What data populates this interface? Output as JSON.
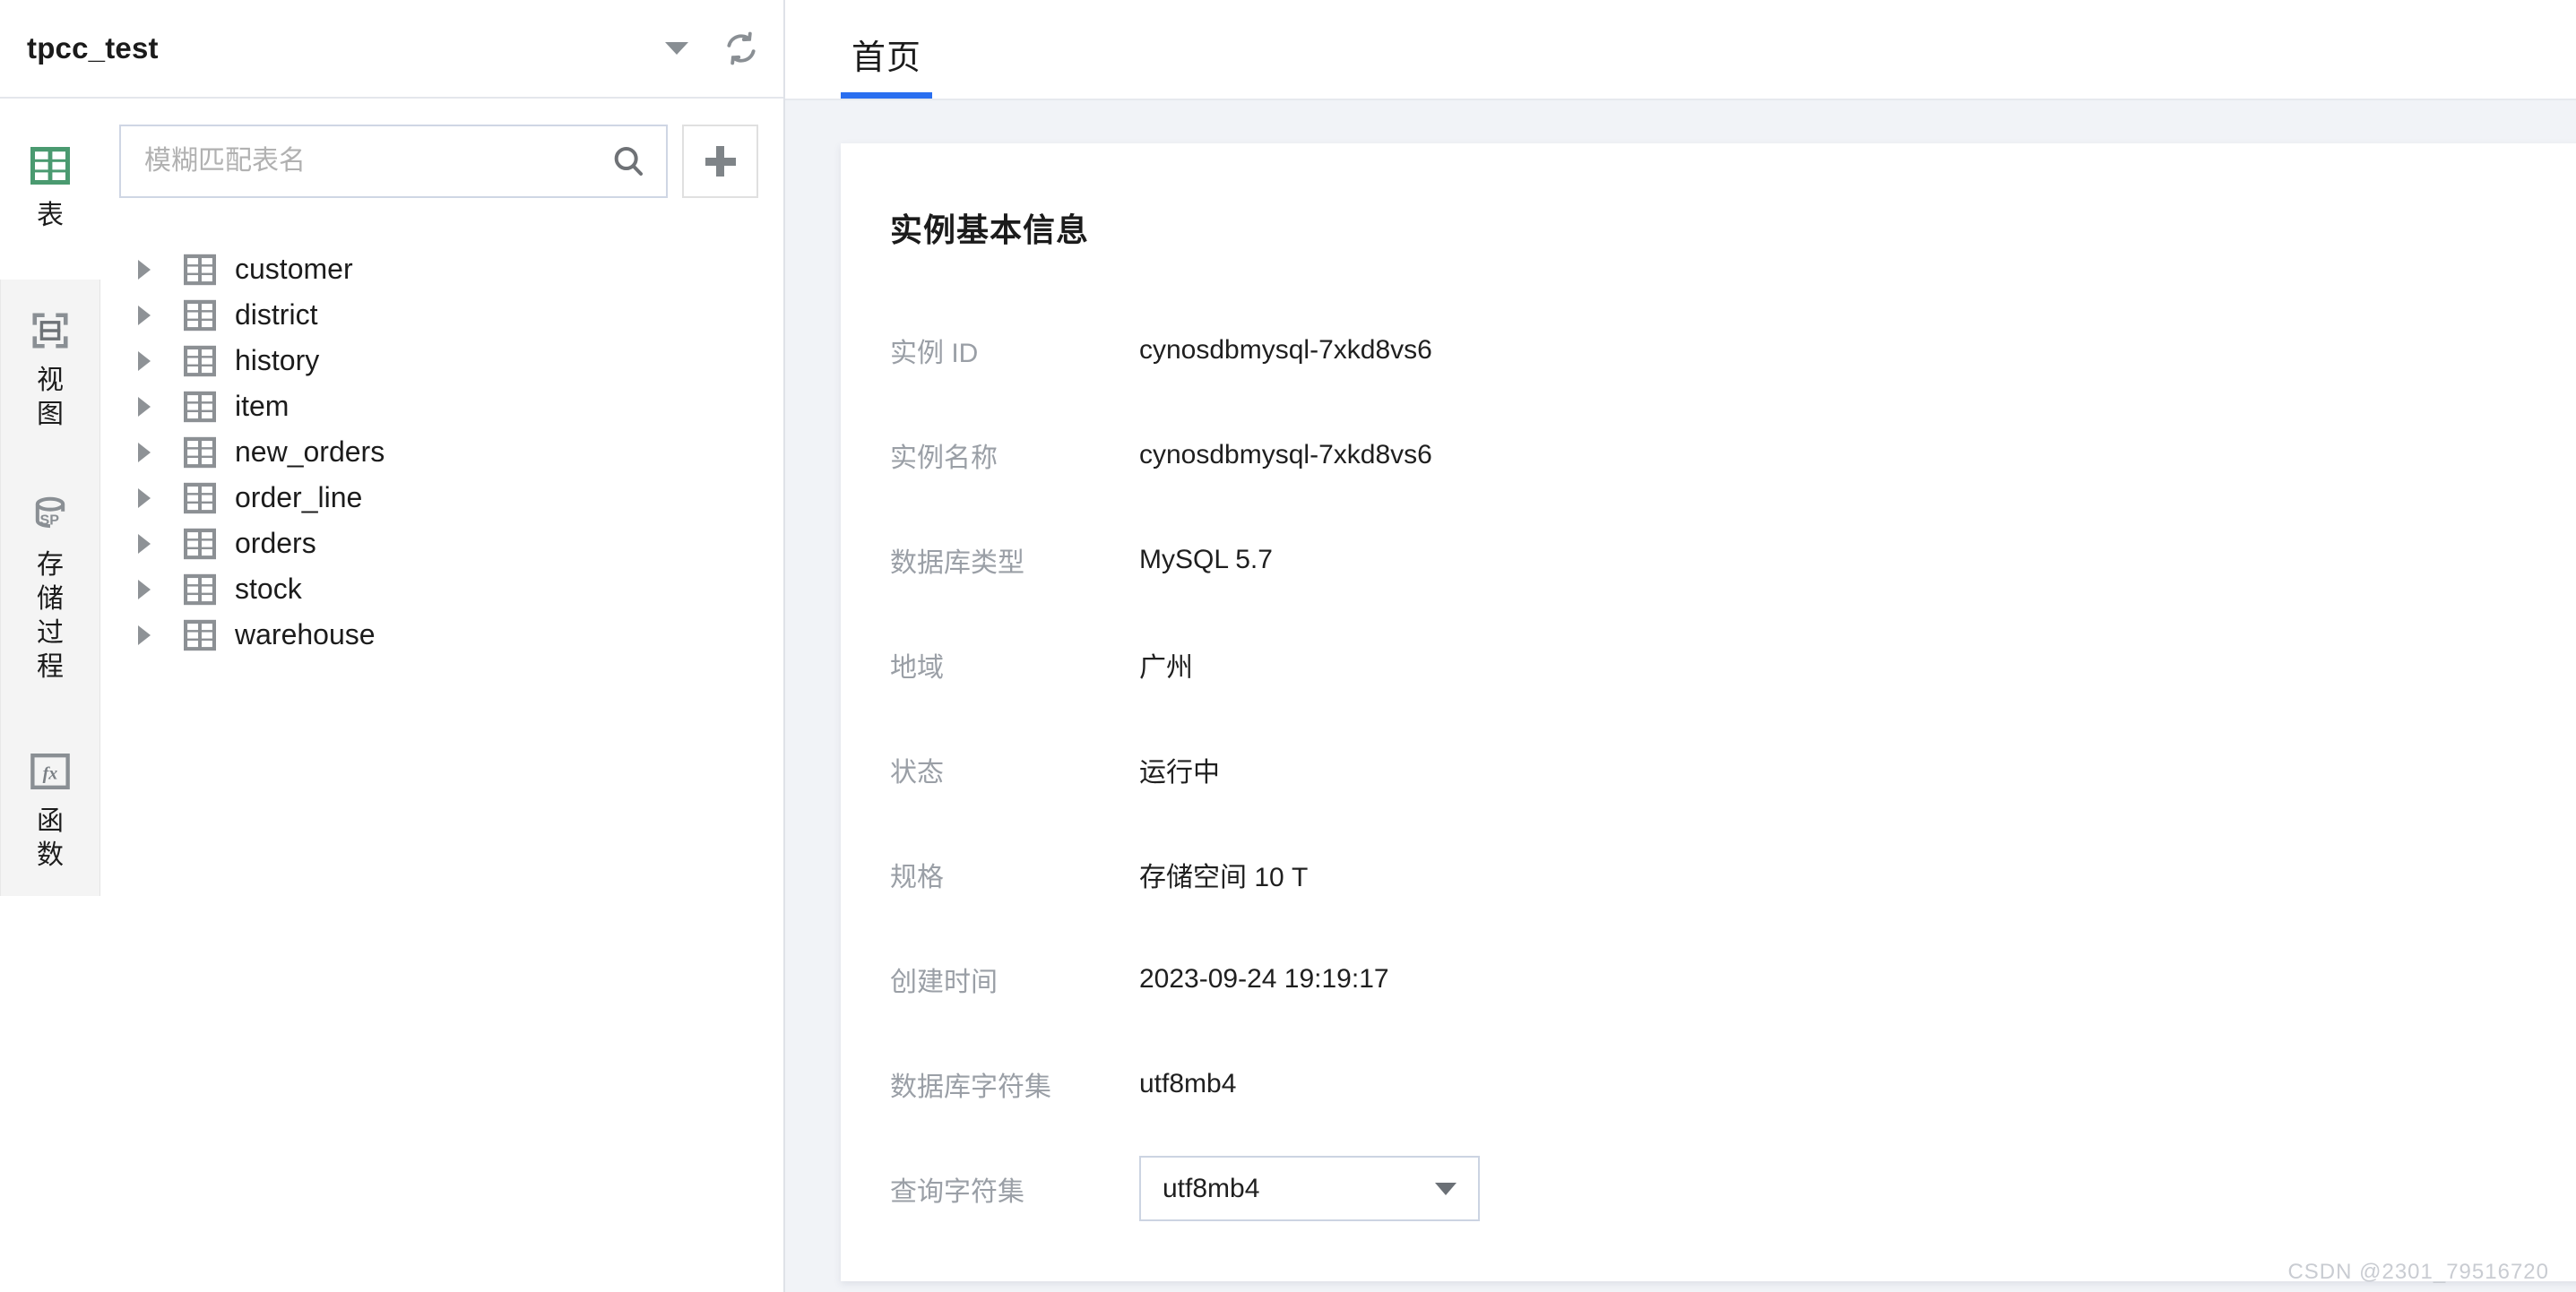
{
  "left_panel": {
    "database_name": "tpcc_test",
    "caret_icon": "chevron-down-icon",
    "refresh_icon": "refresh-icon",
    "search": {
      "placeholder": "模糊匹配表名",
      "value": "",
      "icon": "search-icon"
    },
    "add_button_label": "+",
    "rail": [
      {
        "label": "表",
        "icon": "table-grid-icon",
        "active": true,
        "color": "#4a9a70"
      },
      {
        "label": "视图",
        "icon": "view-frame-icon",
        "active": false,
        "color": "#8a8f94"
      },
      {
        "label": "存储过程",
        "icon": "stored-procedure-icon",
        "active": false,
        "color": "#8a8f94"
      },
      {
        "label": "函数",
        "icon": "fx-function-icon",
        "active": false,
        "color": "#8a8f94"
      }
    ],
    "tables": [
      {
        "name": "customer"
      },
      {
        "name": "district"
      },
      {
        "name": "history"
      },
      {
        "name": "item"
      },
      {
        "name": "new_orders"
      },
      {
        "name": "order_line"
      },
      {
        "name": "orders"
      },
      {
        "name": "stock"
      },
      {
        "name": "warehouse"
      }
    ]
  },
  "right_panel": {
    "tabs": [
      {
        "label": "首页",
        "active": true
      }
    ],
    "card": {
      "title": "实例基本信息",
      "rows": [
        {
          "label": "实例 ID",
          "value": "cynosdbmysql-7xkd8vs6",
          "type": "text"
        },
        {
          "label": "实例名称",
          "value": "cynosdbmysql-7xkd8vs6",
          "type": "text"
        },
        {
          "label": "数据库类型",
          "value": "MySQL 5.7",
          "type": "text"
        },
        {
          "label": "地域",
          "value": "广州",
          "type": "text"
        },
        {
          "label": "状态",
          "value": "运行中",
          "type": "text"
        },
        {
          "label": "规格",
          "value": "存储空间 10 T",
          "type": "text"
        },
        {
          "label": "创建时间",
          "value": "2023-09-24 19:19:17",
          "type": "text"
        },
        {
          "label": "数据库字符集",
          "value": "utf8mb4",
          "type": "text"
        },
        {
          "label": "查询字符集",
          "value": "utf8mb4",
          "type": "select"
        }
      ]
    }
  },
  "watermark": "CSDN @2301_79516720",
  "colors": {
    "accent_blue": "#2a6ff0",
    "active_green": "#4a9a70",
    "label_gray": "#9a9fa6",
    "panel_bg": "#f1f3f7"
  }
}
